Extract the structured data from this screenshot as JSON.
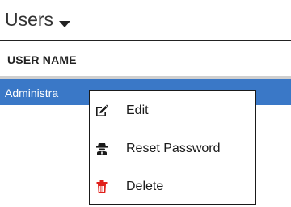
{
  "header": {
    "title": "Users",
    "caret_icon": "caret-down-icon"
  },
  "table": {
    "columns": [
      "USER NAME"
    ],
    "rows": [
      {
        "user_name": "Administra",
        "selected": true
      }
    ]
  },
  "context_menu": {
    "items": [
      {
        "label": "Edit",
        "icon": "edit-icon"
      },
      {
        "label": "Reset Password",
        "icon": "spy-icon"
      },
      {
        "label": "Delete",
        "icon": "trash-icon"
      }
    ]
  },
  "colors": {
    "selection": "#3a78c7",
    "delete_icon": "#e0201b"
  }
}
